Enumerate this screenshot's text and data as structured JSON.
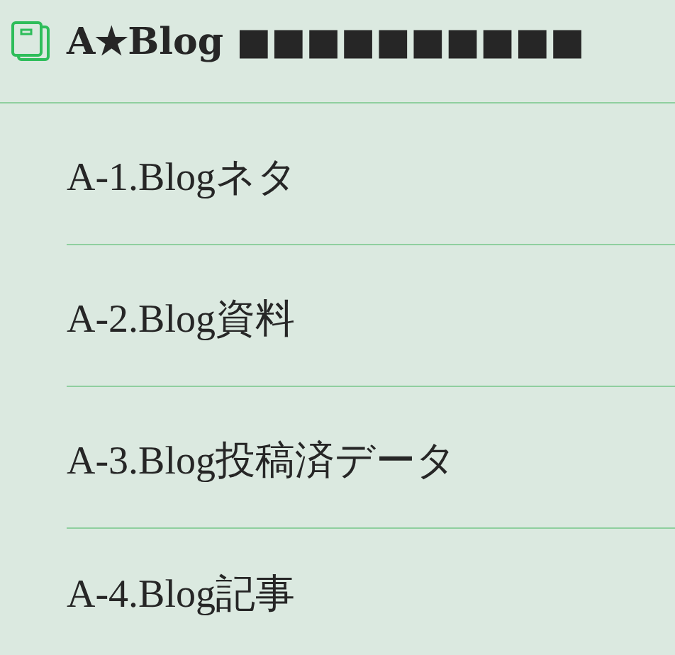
{
  "header": {
    "title": "A★Blog ■■■■■■■■■■"
  },
  "items": [
    {
      "label": "A-1.Blogネタ"
    },
    {
      "label": "A-2.Blog資料"
    },
    {
      "label": "A-3.Blog投稿済データ"
    },
    {
      "label": "A-4.Blog記事"
    }
  ]
}
